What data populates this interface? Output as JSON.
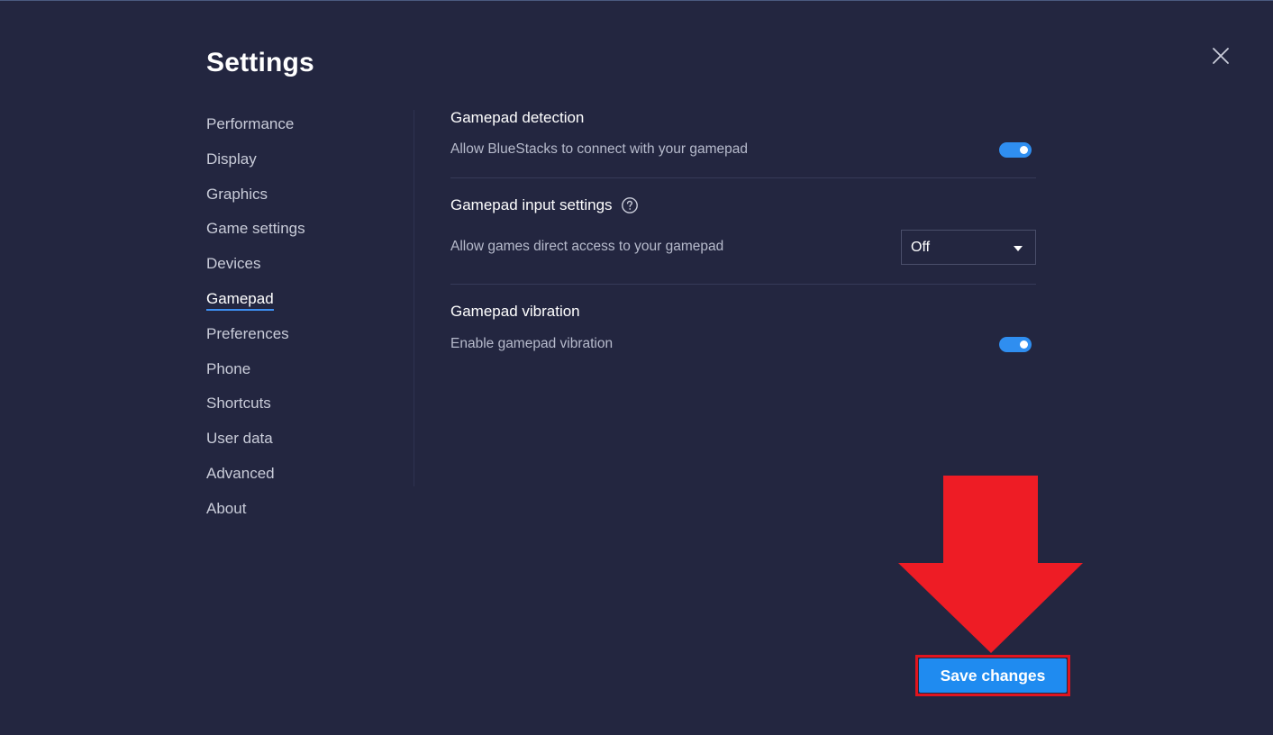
{
  "page": {
    "title": "Settings",
    "close_icon": "close-icon"
  },
  "sidebar": {
    "active": "Gamepad",
    "items": [
      {
        "label": "Performance"
      },
      {
        "label": "Display"
      },
      {
        "label": "Graphics"
      },
      {
        "label": "Game settings"
      },
      {
        "label": "Devices"
      },
      {
        "label": "Gamepad"
      },
      {
        "label": "Preferences"
      },
      {
        "label": "Phone"
      },
      {
        "label": "Shortcuts"
      },
      {
        "label": "User data"
      },
      {
        "label": "Advanced"
      },
      {
        "label": "About"
      }
    ]
  },
  "gamepad": {
    "detection": {
      "title": "Gamepad detection",
      "description": "Allow BlueStacks to connect with your gamepad",
      "enabled": true
    },
    "input_settings": {
      "title": "Gamepad input settings",
      "help_icon": "help-circle-icon",
      "description": "Allow games direct access to your gamepad",
      "selected": "Off"
    },
    "vibration": {
      "title": "Gamepad vibration",
      "description": "Enable gamepad vibration",
      "enabled": true
    }
  },
  "footer": {
    "save_label": "Save changes"
  },
  "annotation": {
    "arrow_icon": "down-arrow-icon",
    "color": "#ee1c25"
  },
  "colors": {
    "background": "#232640",
    "accent": "#1f8bf0"
  }
}
